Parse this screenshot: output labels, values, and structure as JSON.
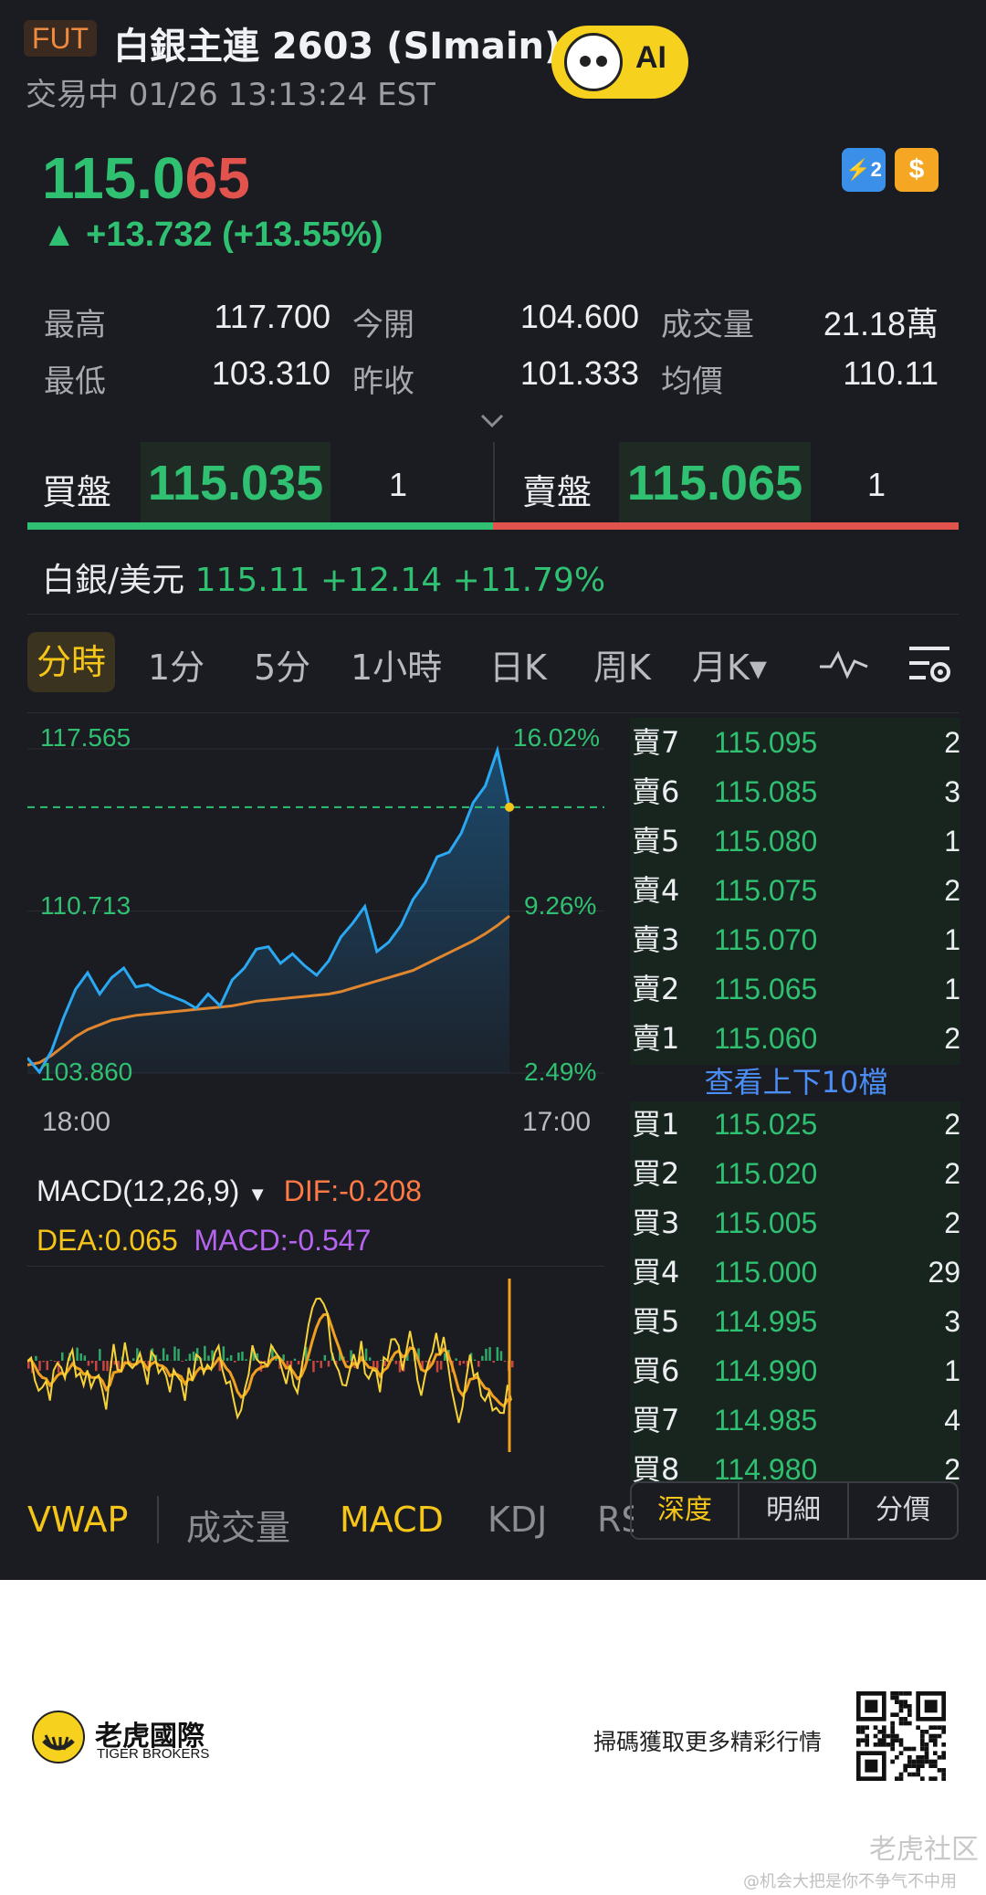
{
  "header": {
    "badge": "FUT",
    "title": "白銀主連 2603 (SImain)",
    "status_time": "交易中 01/26 13:13:24 EST",
    "ai_label": "AI"
  },
  "quote": {
    "price": "115.065",
    "change": "▲ +13.732 (+13.55%)",
    "icon_lv2": "⚡2",
    "icon_dollar": "$"
  },
  "stats": [
    {
      "label": "最高",
      "value": "117.700"
    },
    {
      "label": "今開",
      "value": "104.600"
    },
    {
      "label": "成交量",
      "value": "21.18萬"
    },
    {
      "label": "最低",
      "value": "103.310"
    },
    {
      "label": "昨收",
      "value": "101.333"
    },
    {
      "label": "均價",
      "value": "110.11"
    }
  ],
  "bid": {
    "label": "買盤",
    "price": "115.035",
    "qty": "1"
  },
  "ask": {
    "label": "賣盤",
    "price": "115.065",
    "qty": "1"
  },
  "reference": {
    "name": "白銀/美元",
    "value": "115.11 +12.14 +11.79%"
  },
  "tabs": [
    "分時",
    "1分",
    "5分",
    "1小時",
    "日K",
    "周K",
    "月K▾"
  ],
  "chart_labels": {
    "y_top": "117.565",
    "pct_top": "16.02%",
    "y_mid": "110.713",
    "pct_mid": "9.26%",
    "y_bot": "103.860",
    "pct_bot": "2.49%",
    "t_start": "18:00",
    "t_end": "17:00"
  },
  "chart_data": {
    "type": "line",
    "ylim": [
      103.86,
      117.565
    ],
    "xlabels": [
      "18:00",
      "17:00"
    ],
    "series": [
      {
        "values": [
          104.5,
          103.9,
          104.8,
          106.2,
          107.4,
          108.1,
          107.2,
          107.9,
          108.3,
          107.5,
          107.6,
          107.3,
          107.1,
          106.9,
          106.6,
          107.2,
          106.7,
          107.8,
          108.3,
          109.1,
          109.2,
          108.5,
          108.9,
          108.4,
          108.0,
          108.6,
          109.6,
          110.2,
          110.9,
          109.0,
          109.4,
          110.1,
          111.2,
          111.9,
          113.0,
          113.2,
          114.0,
          115.3,
          116.0,
          117.5,
          115.1
        ]
      },
      {
        "values": [
          104.2,
          104.3,
          104.6,
          105.0,
          105.4,
          105.7,
          105.9,
          106.1,
          106.2,
          106.3,
          106.35,
          106.4,
          106.45,
          106.5,
          106.55,
          106.6,
          106.65,
          106.7,
          106.8,
          106.9,
          106.95,
          107.0,
          107.05,
          107.1,
          107.15,
          107.2,
          107.3,
          107.45,
          107.6,
          107.75,
          107.9,
          108.05,
          108.2,
          108.45,
          108.7,
          108.95,
          109.2,
          109.45,
          109.75,
          110.1,
          110.5
        ]
      }
    ]
  },
  "colors": {
    "up": "#2fc071",
    "down": "#e3534d",
    "price_line": "#2aa8f2",
    "avg_line": "#e0862e",
    "accent": "#f5c518"
  },
  "orderbook": {
    "asks": [
      {
        "name": "賣7",
        "price": "115.095",
        "qty": "2"
      },
      {
        "name": "賣6",
        "price": "115.085",
        "qty": "3"
      },
      {
        "name": "賣5",
        "price": "115.080",
        "qty": "1"
      },
      {
        "name": "賣4",
        "price": "115.075",
        "qty": "2"
      },
      {
        "name": "賣3",
        "price": "115.070",
        "qty": "1"
      },
      {
        "name": "賣2",
        "price": "115.065",
        "qty": "1"
      },
      {
        "name": "賣1",
        "price": "115.060",
        "qty": "2"
      }
    ],
    "more_link": "查看上下10檔",
    "bids": [
      {
        "name": "買1",
        "price": "115.025",
        "qty": "2"
      },
      {
        "name": "買2",
        "price": "115.020",
        "qty": "2"
      },
      {
        "name": "買3",
        "price": "115.005",
        "qty": "2"
      },
      {
        "name": "買4",
        "price": "115.000",
        "qty": "29"
      },
      {
        "name": "買5",
        "price": "114.995",
        "qty": "3"
      },
      {
        "name": "買6",
        "price": "114.990",
        "qty": "1"
      },
      {
        "name": "買7",
        "price": "114.985",
        "qty": "4"
      },
      {
        "name": "買8",
        "price": "114.980",
        "qty": "2"
      }
    ]
  },
  "macd": {
    "title": "MACD(12,26,9)",
    "dif": "DIF:-0.208",
    "dea": "DEA:0.065",
    "macd": "MACD:-0.547"
  },
  "indicator_tabs": [
    "VWAP",
    "成交量",
    "MACD",
    "KDJ",
    "RS"
  ],
  "segments": [
    "深度",
    "明細",
    "分價"
  ],
  "footer": {
    "brand": "老虎國際",
    "brand_en": "TIGER BROKERS",
    "cta": "掃碼獲取更多精彩行情",
    "watermark": "老虎社区",
    "watermark_sub": "@机会大把是你不争气不中用"
  }
}
